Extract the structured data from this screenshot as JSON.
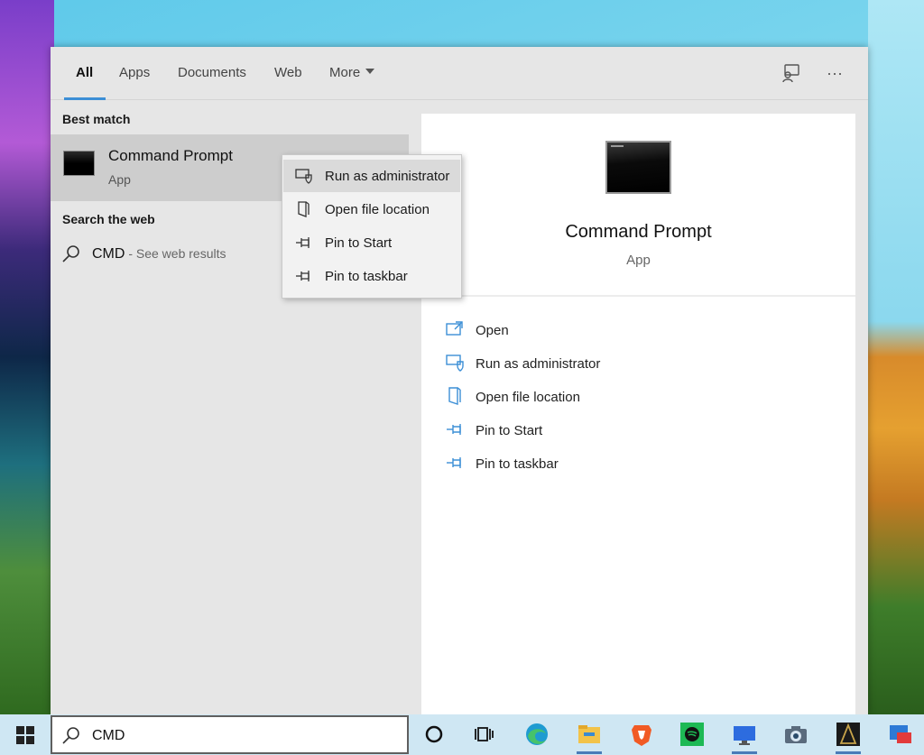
{
  "tabs": [
    {
      "label": "All",
      "active": true
    },
    {
      "label": "Apps"
    },
    {
      "label": "Documents"
    },
    {
      "label": "Web"
    },
    {
      "label": "More"
    }
  ],
  "toolbar_icons": [
    "feedback-icon",
    "more-options-icon"
  ],
  "more_options_glyph": "···",
  "best_match": {
    "heading": "Best match",
    "title": "Command Prompt",
    "subtitle": "App"
  },
  "search_web": {
    "heading": "Search the web",
    "query": "CMD",
    "suffix": " - See web results"
  },
  "detail": {
    "title": "Command Prompt",
    "subtitle": "App",
    "actions": [
      {
        "label": "Open",
        "icon": "open-icon"
      },
      {
        "label": "Run as administrator",
        "icon": "shield-icon"
      },
      {
        "label": "Open file location",
        "icon": "file-location-icon"
      },
      {
        "label": "Pin to Start",
        "icon": "pin-icon"
      },
      {
        "label": "Pin to taskbar",
        "icon": "pin-icon"
      }
    ]
  },
  "context_menu": {
    "items": [
      {
        "label": "Run as administrator",
        "icon": "shield-icon",
        "highlighted": true
      },
      {
        "label": "Open file location",
        "icon": "file-location-icon"
      },
      {
        "label": "Pin to Start",
        "icon": "pin-icon"
      },
      {
        "label": "Pin to taskbar",
        "icon": "pin-icon"
      }
    ]
  },
  "taskbar": {
    "search_value": "CMD",
    "apps": [
      "cortana-icon",
      "task-view-icon",
      "edge-icon",
      "file-explorer-icon",
      "brave-icon",
      "spotify-icon",
      "remote-desktop-icon",
      "camera-icon",
      "game-icon",
      "app-icon"
    ]
  },
  "colors": {
    "accent": "#3c8fd6",
    "panel_bg": "#e6e6e6",
    "selected_bg": "#cdcdcd",
    "taskbar_bg": "#cfe7f3"
  }
}
